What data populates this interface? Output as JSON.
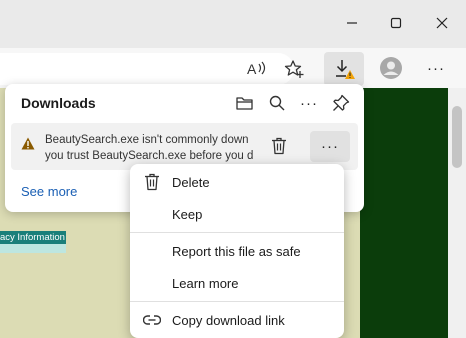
{
  "window_controls": {
    "minimize_icon": "minimize-icon",
    "maximize_icon": "maximize-icon",
    "close_icon": "close-icon"
  },
  "toolbar": {
    "read_aloud_icon": "read-aloud-icon",
    "favorites_icon": "add-favorite-icon",
    "downloads_icon": "download-warning-icon",
    "profile_icon": "profile-avatar-icon",
    "menu_label": "···"
  },
  "page": {
    "privacy_text": "acy Information"
  },
  "downloads_panel": {
    "title": "Downloads",
    "header_icons": [
      "open-folder-icon",
      "search-icon",
      "more-options-icon",
      "pin-icon"
    ],
    "more_options_label": "···",
    "item": {
      "warning_icon": "warning-triangle-icon",
      "line1": "BeautySearch.exe isn't commonly down",
      "line2": "you trust BeautySearch.exe before you d",
      "more_label": "···"
    },
    "see_more": "See more"
  },
  "context_menu": {
    "items": [
      {
        "label": "Delete",
        "icon": "trash-icon"
      },
      {
        "label": "Keep",
        "icon": ""
      },
      {
        "label": "Report this file as safe",
        "icon": ""
      },
      {
        "label": "Learn more",
        "icon": ""
      },
      {
        "label": "Copy download link",
        "icon": "link-icon"
      }
    ]
  },
  "colors": {
    "page_green": "#0b3d0b",
    "link_blue": "#1a5fb4",
    "warning_orange": "#f2a40a"
  }
}
